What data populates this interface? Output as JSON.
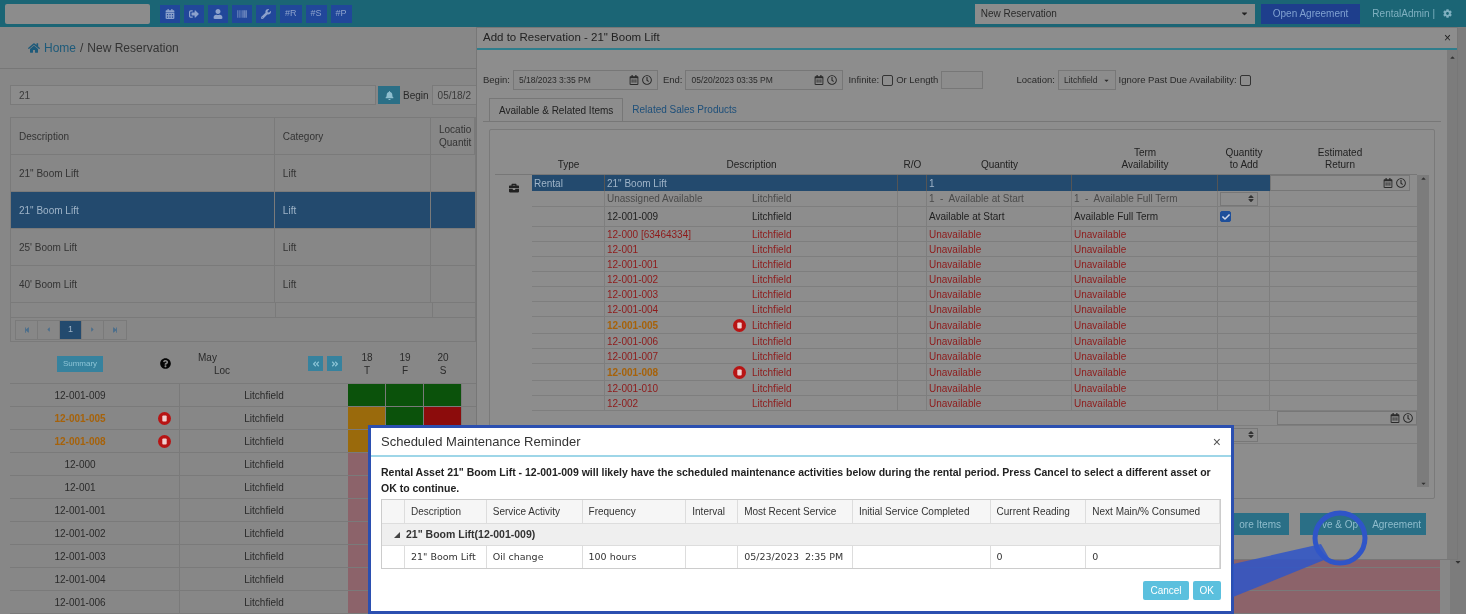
{
  "top_bar": {
    "text_buttons": [
      "#R",
      "#S",
      "#P"
    ],
    "page_select": "New Reservation",
    "open_agreement": "Open Agreement",
    "user": "RentalAdmin |"
  },
  "breadcrumb": {
    "home": "Home",
    "separator": "/",
    "current": "New Reservation"
  },
  "search": {
    "value": "21",
    "begin_label": "Begin",
    "begin_value": "05/18/2"
  },
  "products_table": {
    "columns": [
      [
        "Description"
      ],
      [
        "Category"
      ],
      [
        "Locatio",
        "Quantit"
      ]
    ],
    "rows": [
      {
        "description": "21\" Boom Lift",
        "category": "Lift",
        "selected": false
      },
      {
        "description": "21\" Boom Lift",
        "category": "Lift",
        "selected": true
      },
      {
        "description": "25' Boom Lift",
        "category": "Lift",
        "selected": false
      },
      {
        "description": "40' Boom Lift",
        "category": "Lift",
        "selected": false
      }
    ]
  },
  "pager": {
    "pages": [
      {
        "label": "1",
        "selected": true
      }
    ]
  },
  "schedule": {
    "summary": "Summary",
    "month": "May",
    "loc_header": "Loc",
    "days": [
      {
        "date": "18",
        "weekday": "T"
      },
      {
        "date": "19",
        "weekday": "F"
      },
      {
        "date": "20",
        "weekday": "S"
      }
    ],
    "rows": [
      {
        "asset": "12-001-009",
        "warning": false,
        "location": "Litchfield",
        "cells": [
          {
            "color": "#0b520b"
          },
          {
            "color": "#0b520b"
          },
          {
            "color": "#0b520b"
          }
        ]
      },
      {
        "asset": "12-001-005",
        "warning": true,
        "location": "Litchfield",
        "cells": [
          {
            "color": "#9a6a0c"
          },
          {
            "color": "#0b520b"
          },
          {
            "color": "#8c0c0c"
          }
        ]
      },
      {
        "asset": "12-001-008",
        "warning": true,
        "location": "Litchfield",
        "cells": [
          {
            "color": "#9a6a0c"
          }
        ]
      },
      {
        "asset": "12-000",
        "warning": false,
        "location": "Litchfield",
        "cells": [
          {
            "color": "#8c636a"
          }
        ]
      },
      {
        "asset": "12-001",
        "warning": false,
        "location": "Litchfield",
        "cells": [
          {
            "color": "#8c636a"
          }
        ]
      },
      {
        "asset": "12-001-001",
        "warning": false,
        "location": "Litchfield",
        "cells": [
          {
            "color": "#8c636a"
          }
        ]
      },
      {
        "asset": "12-001-002",
        "warning": false,
        "location": "Litchfield",
        "cells": [
          {
            "color": "#8c636a"
          }
        ]
      },
      {
        "asset": "12-001-003",
        "warning": false,
        "location": "Litchfield",
        "cells": [
          {
            "color": "#8c636a"
          }
        ]
      },
      {
        "asset": "12-001-004",
        "warning": false,
        "location": "Litchfield",
        "cells": [
          {
            "color": "#8c636a"
          }
        ]
      },
      {
        "asset": "12-001-006",
        "warning": false,
        "location": "Litchfield",
        "cells": [
          {
            "color": "#8c636a"
          }
        ]
      }
    ]
  },
  "dialog": {
    "title": "Add to Reservation - 21\" Boom Lift",
    "begin_label": "Begin:",
    "begin": "5/18/2023 3:35 PM",
    "end_label": "End:",
    "end": "05/20/2023 03:35 PM",
    "infinite_label": "Infinite:",
    "infinite": false,
    "or_length_label": "Or Length",
    "location_label": "Location:",
    "location": "Litchfield",
    "ignore_label": "Ignore Past Due Availability:",
    "ignore_past_due": false,
    "tabs": [
      {
        "label": "Available & Related Items",
        "selected": true
      },
      {
        "label": "Related Sales Products",
        "selected": false
      }
    ],
    "columns": [
      [
        "Type"
      ],
      [
        "Description"
      ],
      [
        "R/O"
      ],
      [
        "Quantity"
      ],
      [
        "Term",
        "Availability"
      ],
      [
        "Quantity",
        "to Add"
      ],
      [
        "Estimated",
        "Return"
      ]
    ],
    "group": {
      "type": "Rental",
      "description": "21\" Boom Lift",
      "quantity": "1",
      "selected": true
    },
    "rows": [
      {
        "asset": "Unassigned Available",
        "location": "Litchfield",
        "quantity": "1  -  Available at Start",
        "term": "1  -  Available Full Term",
        "unassigned": true,
        "unavailable": false,
        "warning": false,
        "kind": "spinner"
      },
      {
        "asset": "12-001-009",
        "location": "Litchfield",
        "quantity": "Available at Start",
        "term": "Available Full Term",
        "unassigned": false,
        "unavailable": false,
        "warning": false,
        "kind": "checkbox",
        "checked": true
      },
      {
        "asset": "12-000 [63464334]",
        "location": "Litchfield",
        "quantity": "Unavailable",
        "term": "Unavailable",
        "unassigned": false,
        "unavailable": true,
        "warning": false,
        "kind": "none"
      },
      {
        "asset": "12-001",
        "location": "Litchfield",
        "quantity": "Unavailable",
        "term": "Unavailable",
        "unassigned": false,
        "unavailable": true,
        "warning": false,
        "kind": "none"
      },
      {
        "asset": "12-001-001",
        "location": "Litchfield",
        "quantity": "Unavailable",
        "term": "Unavailable",
        "unassigned": false,
        "unavailable": true,
        "warning": false,
        "kind": "none"
      },
      {
        "asset": "12-001-002",
        "location": "Litchfield",
        "quantity": "Unavailable",
        "term": "Unavailable",
        "unassigned": false,
        "unavailable": true,
        "warning": false,
        "kind": "none"
      },
      {
        "asset": "12-001-003",
        "location": "Litchfield",
        "quantity": "Unavailable",
        "term": "Unavailable",
        "unassigned": false,
        "unavailable": true,
        "warning": false,
        "kind": "none"
      },
      {
        "asset": "12-001-004",
        "location": "Litchfield",
        "quantity": "Unavailable",
        "term": "Unavailable",
        "unassigned": false,
        "unavailable": true,
        "warning": false,
        "kind": "none"
      },
      {
        "asset": "12-001-005",
        "location": "Litchfield",
        "quantity": "Unavailable",
        "term": "Unavailable",
        "unassigned": false,
        "unavailable": true,
        "warning": true,
        "kind": "none"
      },
      {
        "asset": "12-001-006",
        "location": "Litchfield",
        "quantity": "Unavailable",
        "term": "Unavailable",
        "unassigned": false,
        "unavailable": true,
        "warning": false,
        "kind": "none"
      },
      {
        "asset": "12-001-007",
        "location": "Litchfield",
        "quantity": "Unavailable",
        "term": "Unavailable",
        "unassigned": false,
        "unavailable": true,
        "warning": false,
        "kind": "none"
      },
      {
        "asset": "12-001-008",
        "location": "Litchfield",
        "quantity": "Unavailable",
        "term": "Unavailable",
        "unassigned": false,
        "unavailable": true,
        "warning": true,
        "kind": "none"
      },
      {
        "asset": "12-001-010",
        "location": "Litchfield",
        "quantity": "Unavailable",
        "term": "Unavailable",
        "unassigned": false,
        "unavailable": true,
        "warning": false,
        "kind": "none"
      },
      {
        "asset": "12-002",
        "location": "Litchfield",
        "quantity": "Unavailable",
        "term": "Unavailable",
        "unassigned": false,
        "unavailable": true,
        "warning": false,
        "kind": "none"
      }
    ],
    "buttons": [
      {
        "parts": [
          "ore Items"
        ]
      },
      {
        "parts": [
          "ve & Op",
          "Agreement"
        ]
      }
    ]
  },
  "modal": {
    "title": "Scheduled Maintenance Reminder",
    "close": "×",
    "message": "Rental Asset 21\" Boom Lift - 12-001-009 will likely have the scheduled maintenance activities below during the rental period. Press Cancel to select a different asset or OK to continue.",
    "columns": [
      "Description",
      "Service Activity",
      "Frequency",
      "Interval",
      "Most Recent Service",
      "Initial Service Completed",
      "Current Reading",
      "Next Main/% Consumed"
    ],
    "group": {
      "label": "21\" Boom Lift(12-001-009)",
      "expanded": true
    },
    "rows": [
      {
        "cells": [
          "21\" Boom Lift",
          "Oil change",
          "100 hours",
          "",
          "05/23/2023  2:35 PM",
          "",
          "0",
          "0"
        ]
      }
    ],
    "buttons": [
      "Cancel",
      "OK"
    ]
  }
}
